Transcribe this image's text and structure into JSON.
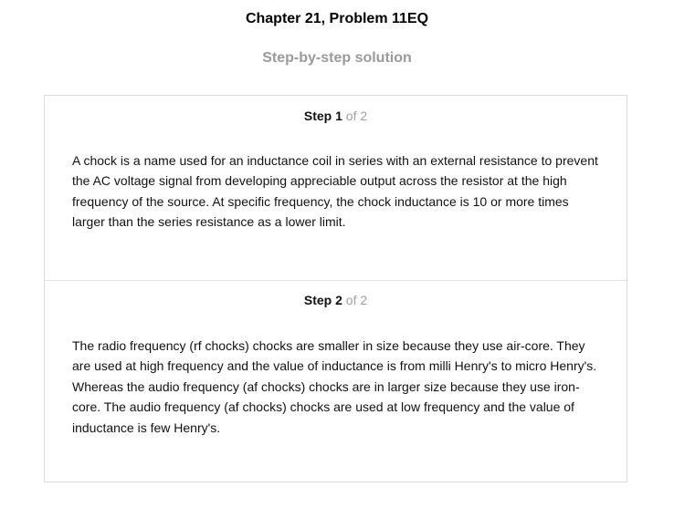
{
  "header": {
    "title": "Chapter 21, Problem 11EQ",
    "subtitle": "Step-by-step solution"
  },
  "steps": [
    {
      "label": "Step",
      "number": "1",
      "of_text": "of 2",
      "text": "A chock is a name used for an inductance coil in series with an external resistance to prevent the AC voltage signal from developing appreciable output across the resistor at the high frequency of the source. At specific frequency, the chock inductance is 10 or more times larger than the series resistance as a lower limit."
    },
    {
      "label": "Step",
      "number": "2",
      "of_text": "of 2",
      "text": "The radio frequency (rf chocks) chocks are smaller in size because they use air-core. They are used at high frequency and the value of inductance is from milli Henry's to micro Henry's. Whereas the audio frequency (af chocks) chocks are in larger size because they use iron-core. The audio frequency (af chocks) chocks are used at low frequency and the value of inductance is few Henry's."
    }
  ]
}
